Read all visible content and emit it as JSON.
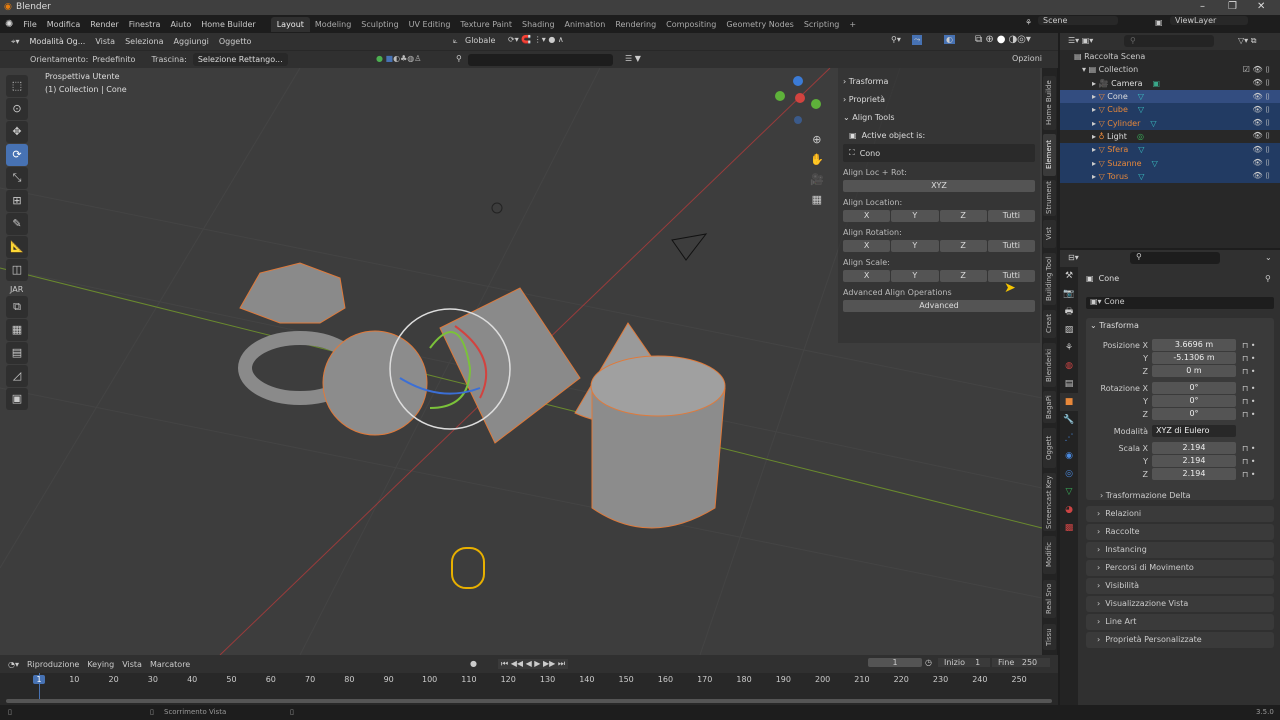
{
  "app": {
    "title": "Blender",
    "version": "3.5.0"
  },
  "menu": [
    "File",
    "Modifica",
    "Render",
    "Finestra",
    "Aiuto",
    "Home Builder"
  ],
  "workspaces": [
    "Layout",
    "Modeling",
    "Sculpting",
    "UV Editing",
    "Texture Paint",
    "Shading",
    "Animation",
    "Rendering",
    "Compositing",
    "Geometry Nodes",
    "Scripting",
    "+"
  ],
  "active_workspace": "Layout",
  "scene": {
    "scene_name": "Scene",
    "view_layer": "ViewLayer"
  },
  "viewport_header": {
    "mode": "Modalità Og...",
    "items": [
      "Vista",
      "Seleziona",
      "Aggiungi",
      "Oggetto"
    ],
    "orientation": "Globale"
  },
  "tool_settings": {
    "orient_label": "Orientamento:",
    "orient_value": "Predefinito",
    "drag_label": "Trascina:",
    "drag_value": "Selezione Rettango...",
    "options": "Opzioni"
  },
  "viewport": {
    "view_name": "Prospettiva Utente",
    "collection_info": "(1) Collection | Cone",
    "tool_section": "JAR",
    "gizmo": {
      "x": "X",
      "y": "Y",
      "z": "Z"
    }
  },
  "npanel": {
    "sections": [
      "Trasforma",
      "Proprietà",
      "Align Tools"
    ],
    "active_label": "Active object is:",
    "active_object": "Cono",
    "loc_rot_label": "Align Loc + Rot:",
    "xyz": "XYZ",
    "location_label": "Align Location:",
    "rotation_label": "Align Rotation:",
    "scale_label": "Align Scale:",
    "axes": [
      "X",
      "Y",
      "Z",
      "Tutti"
    ],
    "advanced_label": "Advanced Align Operations",
    "advanced_button": "Advanced"
  },
  "vertical_tabs": [
    "Home Builde",
    "Element",
    "Strument",
    "Vist",
    "Building Tool",
    "Creat",
    "Blenderki",
    "BagaPi",
    "Oggett",
    "Screencast Key",
    "Modific",
    "Real Sno",
    "Tissu"
  ],
  "outliner": {
    "root": "Raccolta Scena",
    "collection": "Collection",
    "items": [
      {
        "name": "Camera",
        "type": "camera",
        "state": "normal"
      },
      {
        "name": "Cone",
        "type": "mesh",
        "state": "active"
      },
      {
        "name": "Cube",
        "type": "mesh",
        "state": "selected"
      },
      {
        "name": "Cylinder",
        "type": "mesh",
        "state": "selected"
      },
      {
        "name": "Light",
        "type": "light",
        "state": "normal"
      },
      {
        "name": "Sfera",
        "type": "mesh",
        "state": "selected"
      },
      {
        "name": "Suzanne",
        "type": "mesh",
        "state": "selected"
      },
      {
        "name": "Torus",
        "type": "mesh",
        "state": "selected"
      }
    ]
  },
  "properties": {
    "object_name": "Cone",
    "datablock": "Cone",
    "transform_title": "Trasforma",
    "location": {
      "label": "Posizione X",
      "x": "3.6696 m",
      "y": "-5.1306 m",
      "z": "0 m"
    },
    "rotation": {
      "label": "Rotazione X",
      "x": "0°",
      "y": "0°",
      "z": "0°"
    },
    "mode_label": "Modalità",
    "mode_value": "XYZ di Eulero",
    "scale": {
      "label": "Scala X",
      "x": "2.194",
      "y": "2.194",
      "z": "2.194"
    },
    "axis_y": "Y",
    "axis_z": "Z",
    "delta": "Trasformazione Delta",
    "panels": [
      "Relazioni",
      "Raccolte",
      "Instancing",
      "Percorsi di Movimento",
      "Visibilità",
      "Visualizzazione Vista",
      "Line Art",
      "Proprietà Personalizzate"
    ]
  },
  "timeline": {
    "menus": [
      "Riproduzione",
      "Keying",
      "Vista",
      "Marcatore"
    ],
    "current_frame": "1",
    "start_label": "Inizio",
    "start": "1",
    "end_label": "Fine",
    "end": "250",
    "ticks": [
      "1",
      "10",
      "20",
      "30",
      "40",
      "50",
      "60",
      "70",
      "80",
      "90",
      "100",
      "110",
      "120",
      "130",
      "140",
      "150",
      "160",
      "170",
      "180",
      "190",
      "200",
      "210",
      "220",
      "230",
      "240",
      "250"
    ]
  },
  "status": {
    "hint": "Scorrimento Vista"
  }
}
